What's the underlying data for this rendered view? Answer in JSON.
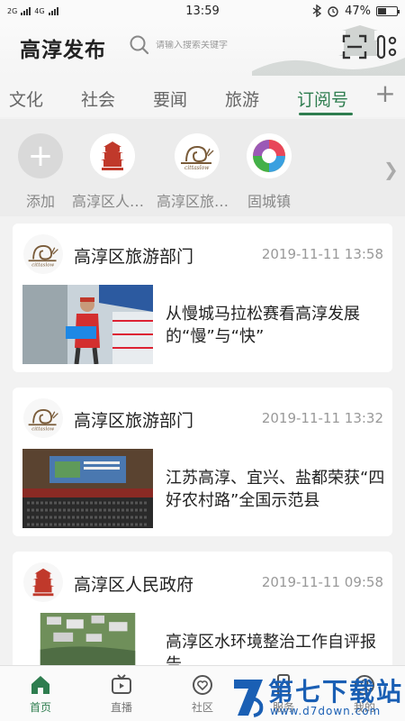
{
  "status_bar": {
    "network_1": "2G",
    "network_2": "4G",
    "time": "13:59",
    "battery": "47%",
    "battery_level": 0.47
  },
  "header": {
    "title": "高淳发布",
    "search_placeholder": "请输入搜索关键字"
  },
  "tabs": [
    {
      "label": "文化",
      "active": false
    },
    {
      "label": "社会",
      "active": false
    },
    {
      "label": "要闻",
      "active": false
    },
    {
      "label": "旅游",
      "active": false
    },
    {
      "label": "订阅号",
      "active": true
    }
  ],
  "subscriptions": [
    {
      "label": "添加",
      "icon": "plus-icon"
    },
    {
      "label": "高淳区人民政府",
      "icon": "pagoda-logo"
    },
    {
      "label": "高淳区旅游部门",
      "icon": "snail-logo"
    },
    {
      "label": "固城镇",
      "icon": "swirl-logo"
    }
  ],
  "feed": [
    {
      "source": "高淳区旅游部门",
      "time": "2019-11-11 13:58",
      "title": "从慢城马拉松赛看高淳发展的“慢”与“快”",
      "logo": "snail-logo",
      "image": "marathon-runner-photo"
    },
    {
      "source": "高淳区旅游部门",
      "time": "2019-11-11 13:32",
      "title": "江苏高淳、宜兴、盐都荣获“四好农村路”全国示范县",
      "logo": "snail-logo",
      "image": "conference-hall-photo"
    },
    {
      "source": "高淳区人民政府",
      "time": "2019-11-11 09:58",
      "title": "高淳区水环境整治工作自评报告",
      "logo": "pagoda-logo",
      "image": "village-aerial-photo"
    }
  ],
  "bottom_nav": [
    {
      "label": "首页",
      "icon": "home-icon",
      "active": true
    },
    {
      "label": "直播",
      "icon": "tv-icon",
      "active": false
    },
    {
      "label": "社区",
      "icon": "heart-icon",
      "active": false
    },
    {
      "label": "服务",
      "icon": "phone-icon",
      "active": false
    },
    {
      "label": "我的",
      "icon": "user-icon",
      "active": false
    }
  ],
  "watermark": {
    "main": "第七下载站",
    "url": "www.d7down.com"
  },
  "colors": {
    "accent": "#2e7d4f",
    "watermark": "#1a5fb4"
  }
}
